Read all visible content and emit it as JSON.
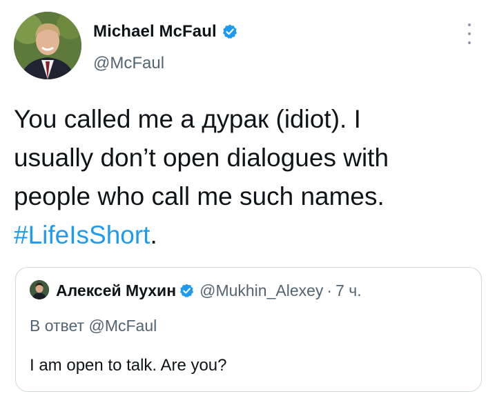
{
  "author": {
    "name": "Michael McFaul",
    "handle": "@McFaul",
    "verified": true
  },
  "tweet": {
    "lines": [
      "You called me a дурак (idiot). I",
      "usually don’t open dialogues with",
      "people who call me such names."
    ],
    "hashtag": "#LifeIsShort",
    "after_hashtag": "."
  },
  "quoted": {
    "name": "Алексей Мухин",
    "handle": "@Mukhin_Alexey",
    "separator": "·",
    "time": "7 ч.",
    "verified": true,
    "reply_prefix": "В ответ",
    "reply_to": "@McFaul",
    "text": "I am open to talk. Are you?"
  },
  "colors": {
    "accent": "#1d9bf0",
    "text_primary": "#0f1419",
    "text_secondary": "#536471",
    "border": "#cfd9de"
  },
  "icons": {
    "verified": "verified-badge-icon",
    "more": "more-options-icon"
  }
}
